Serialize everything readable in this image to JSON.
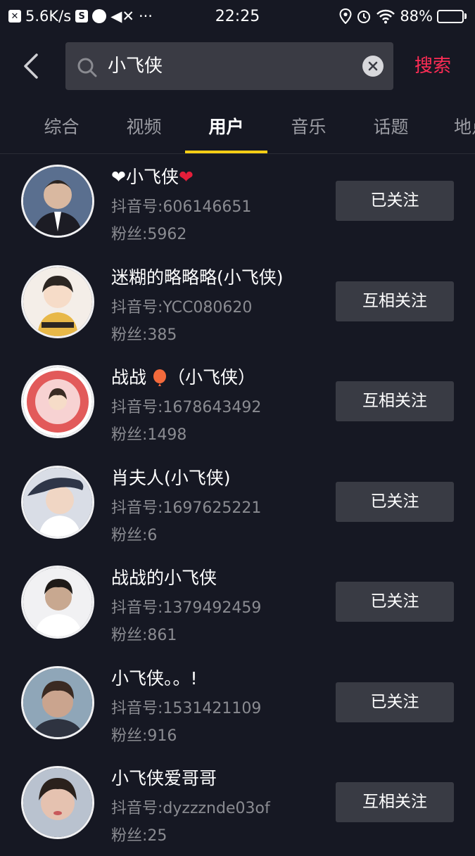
{
  "status_bar": {
    "speed": "5.6K/s",
    "time": "22:25",
    "battery": "88%",
    "battery_level": 0.88
  },
  "search": {
    "query": "小飞侠",
    "submit_label": "搜索"
  },
  "tabs": [
    {
      "label": "综合",
      "active": false
    },
    {
      "label": "视频",
      "active": false
    },
    {
      "label": "用户",
      "active": true
    },
    {
      "label": "音乐",
      "active": false
    },
    {
      "label": "话题",
      "active": false
    },
    {
      "label": "地点",
      "active": false
    }
  ],
  "users": [
    {
      "name": "小飞侠",
      "name_prefix": "❤",
      "name_suffix": "❤",
      "id": "抖音号:606146651",
      "fans": "粉丝:5962",
      "follow": "已关注",
      "avatar_bg": "#5a6f8f",
      "avatar_fg": "#d9b8a0"
    },
    {
      "name": "迷糊的略略略(小飞侠)",
      "id": "抖音号:YCC080620",
      "fans": "粉丝:385",
      "follow": "互相关注",
      "avatar_bg": "#f4eee8",
      "avatar_fg": "#e8b848"
    },
    {
      "name": "战战",
      "name_suffix2": "（小飞侠）",
      "id": "抖音号:1678643492",
      "fans": "粉丝:1498",
      "follow": "互相关注",
      "avatar_bg": "#f7d2d2",
      "avatar_fg": "#e25a5a"
    },
    {
      "name": "肖夫人(小飞侠)",
      "id": "抖音号:1697625221",
      "fans": "粉丝:6",
      "follow": "已关注",
      "avatar_bg": "#d9dde6",
      "avatar_fg": "#2f3648"
    },
    {
      "name": "战战的小飞侠",
      "id": "抖音号:1379492459",
      "fans": "粉丝:861",
      "follow": "已关注",
      "avatar_bg": "#f1f1f3",
      "avatar_fg": "#c8a890"
    },
    {
      "name": "小飞侠。。!",
      "id": "抖音号:1531421109",
      "fans": "粉丝:916",
      "follow": "已关注",
      "avatar_bg": "#8fa6b8",
      "avatar_fg": "#caa48e"
    },
    {
      "name": "小飞侠爱哥哥",
      "id": "抖音号:dyzzznde03of",
      "fans": "粉丝:25",
      "follow": "互相关注",
      "avatar_bg": "#b9c2cf",
      "avatar_fg": "#e5c2b0"
    }
  ]
}
